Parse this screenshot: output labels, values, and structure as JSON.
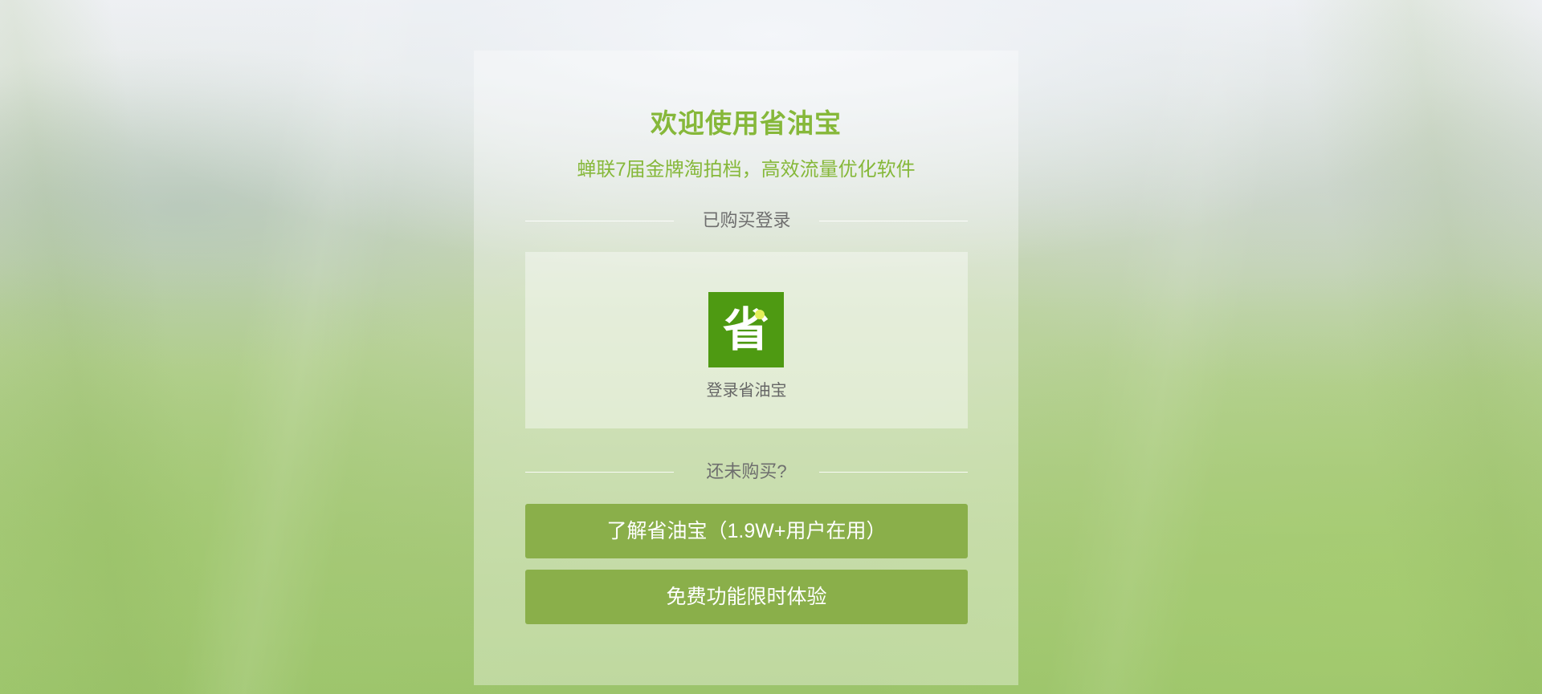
{
  "card": {
    "title": "欢迎使用省油宝",
    "subtitle": "蝉联7届金牌淘拍档，高效流量优化软件",
    "bought_divider": "已购买登录",
    "login": {
      "logo_glyph": "省",
      "label": "登录省油宝"
    },
    "not_bought_divider": "还未购买?",
    "buttons": {
      "learn_more": "了解省油宝（1.9W+用户在用）",
      "free_trial": "免费功能限时体验"
    }
  },
  "colors": {
    "title_green": "#86b83a",
    "logo_green": "#4e9a12",
    "button_green": "#8aaf4a"
  }
}
